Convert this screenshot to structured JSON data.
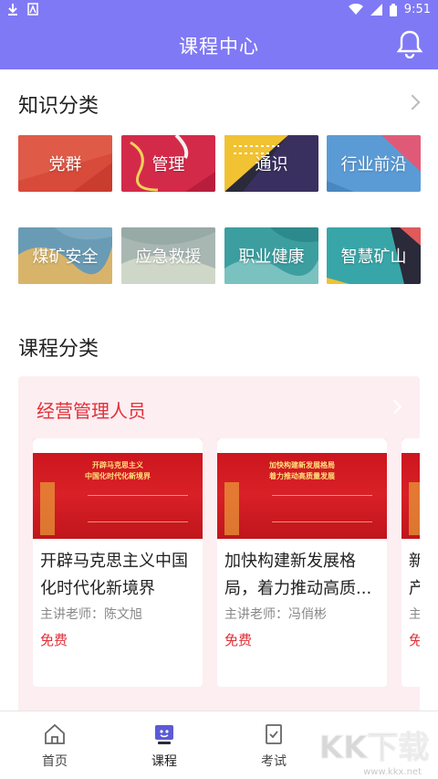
{
  "status_bar": {
    "time": "9:51"
  },
  "app_bar": {
    "title": "课程中心"
  },
  "knowledge": {
    "title": "知识分类",
    "categories": [
      {
        "label": "党群"
      },
      {
        "label": "管理"
      },
      {
        "label": "通识"
      },
      {
        "label": "行业前沿"
      },
      {
        "label": "煤矿安全"
      },
      {
        "label": "应急救援"
      },
      {
        "label": "职业健康"
      },
      {
        "label": "智慧矿山"
      }
    ]
  },
  "course_section": {
    "title": "课程分类",
    "panel_title": "经营管理人员",
    "courses": [
      {
        "banner_line1": "开辟马克思主义",
        "banner_line2": "中国化时代化新境界",
        "title": "开辟马克思主义中国化时代化新境界",
        "teacher": "主讲老师：陈文旭",
        "price": "免费"
      },
      {
        "banner_line1": "加快构建新发展格局",
        "banner_line2": "着力推动高质量发展",
        "title": "加快构建新发展格局，着力推动高质...",
        "teacher": "主讲老师：冯俏彬",
        "price": "免费"
      },
      {
        "banner_line1": "",
        "banner_line2": "",
        "title": "新产",
        "teacher": "主",
        "price": "免"
      }
    ]
  },
  "bottom_nav": [
    {
      "label": "首页",
      "icon": "home-icon"
    },
    {
      "label": "课程",
      "icon": "course-icon"
    },
    {
      "label": "考试",
      "icon": "exam-icon"
    }
  ],
  "watermark": {
    "text": "www.kkx.net",
    "logo": "KK下载"
  },
  "colors": {
    "primary": "#7f79f5",
    "accent_red": "#e0313a",
    "panel_bg": "#fdeef1"
  }
}
